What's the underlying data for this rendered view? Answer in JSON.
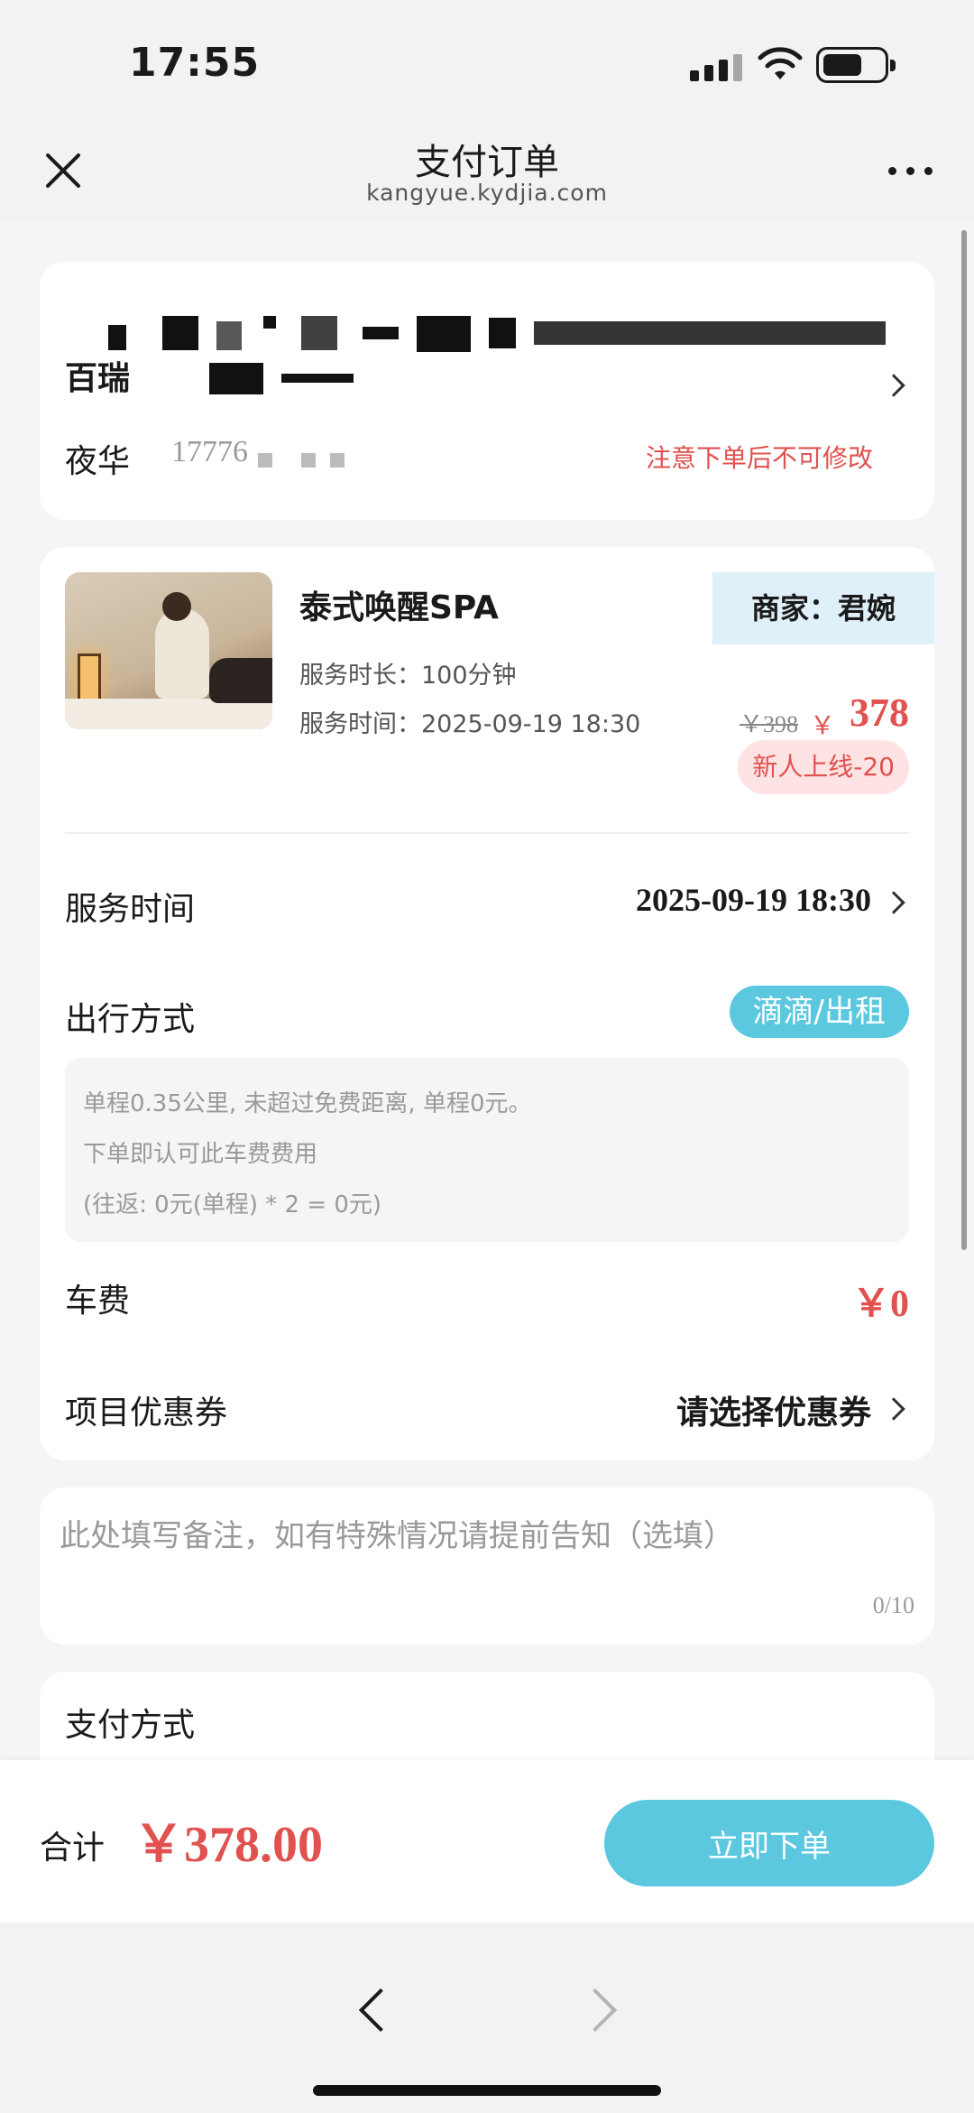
{
  "status": {
    "time": "17:55"
  },
  "nav": {
    "title": "支付订单",
    "subtitle": "kangyue.kydjia.com"
  },
  "address": {
    "line2_prefix": "百瑞",
    "contact_name": "夜华",
    "contact_phone": "17776",
    "notice": "注意下单后不可修改"
  },
  "order": {
    "service_title": "泰式唤醒SPA",
    "merchant_tag": "商家：君婉",
    "duration": "服务时长：100分钟",
    "service_time_label": "服务时间：2025-09-19 18:30",
    "old_price": "￥398",
    "price_symbol": "￥",
    "price": "378",
    "promo": "新人上线-20",
    "rows": {
      "service_time": {
        "label": "服务时间",
        "value": "2025-09-19 18:30"
      },
      "travel": {
        "label": "出行方式",
        "value": "滴滴/出租"
      },
      "fare": {
        "label": "车费",
        "value": "￥0"
      },
      "coupon": {
        "label": "项目优惠券",
        "value": "请选择优惠券"
      }
    },
    "travel_info": [
      "单程0.35公里, 未超过免费距离, 单程0元。",
      "下单即认可此车费费用",
      "(往返: 0元(单程) * 2 = 0元)"
    ]
  },
  "remark": {
    "placeholder": "此处填写备注，如有特殊情况请提前告知（选填）",
    "counter": "0/10"
  },
  "payment": {
    "label": "支付方式"
  },
  "footer": {
    "total_label": "合计",
    "total_amount": "￥378.00",
    "submit_label": "立即下单"
  },
  "colors": {
    "accent": "#5bc8e0",
    "price_red": "#e0514f",
    "tag_bg": "#dff0f8"
  }
}
